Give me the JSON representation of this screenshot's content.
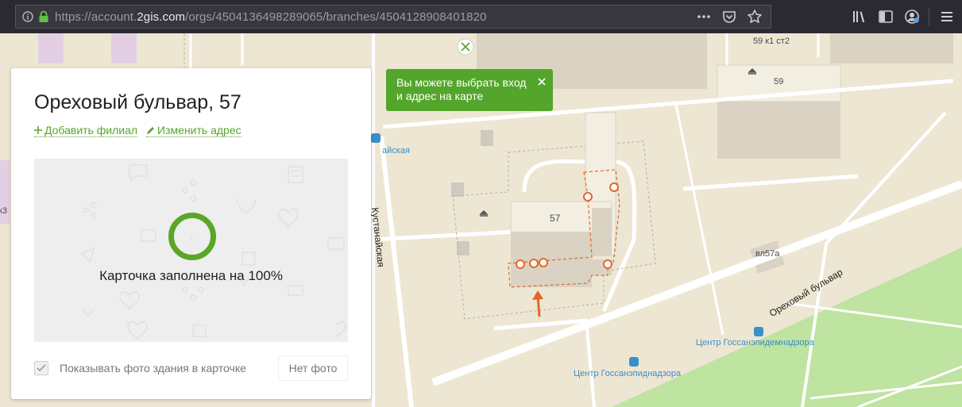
{
  "browser": {
    "url_prefix": "https://account.",
    "url_domain": "2gis.com",
    "url_path": "/orgs/4504136498289065/branches/4504128908401820",
    "url_full": "https://account.2gis.com/orgs/4504136498289065/branches/4504128908401820",
    "icons": {
      "info": "info-icon",
      "lock": "lock-icon",
      "more": "more-icon",
      "pocket": "pocket-icon",
      "bookmark": "star-icon",
      "library": "library-icon",
      "sidebar": "sidebar-icon",
      "account": "account-icon",
      "menu": "menu-icon"
    }
  },
  "card": {
    "title": "Ореховый бульвар, 57",
    "add_branch": "Добавить филиал",
    "edit_address": "Изменить адрес",
    "fill_status": "Карточка заполнена на 100%",
    "fill_percent": 100,
    "show_photo_label": "Показывать фото здания в карточке",
    "show_photo_checked": true,
    "no_photo_button": "Нет фото"
  },
  "tooltip": {
    "text": "Вы можете выбрать вход и адрес на карте"
  },
  "map": {
    "labels": {
      "b59k1": "59 к1 ст2",
      "b59": "59",
      "b57": "57",
      "vl57a": "вл57а",
      "street_kustanayskaya": "Кустанайская",
      "street_orekhovy": "Ореховый бульвар",
      "stop_top": "айская",
      "stop_center1": "Центр Госсанэпиднадзора",
      "stop_center2": "Центр Госсанэпидемнадзора",
      "left_edge": "к3"
    },
    "colors": {
      "background": "#ede6d3",
      "building": "#dad3c3",
      "road": "#ffffff",
      "park": "#bfe3a0",
      "entrance": "#e2672a",
      "brand_green": "#54a52b"
    }
  }
}
